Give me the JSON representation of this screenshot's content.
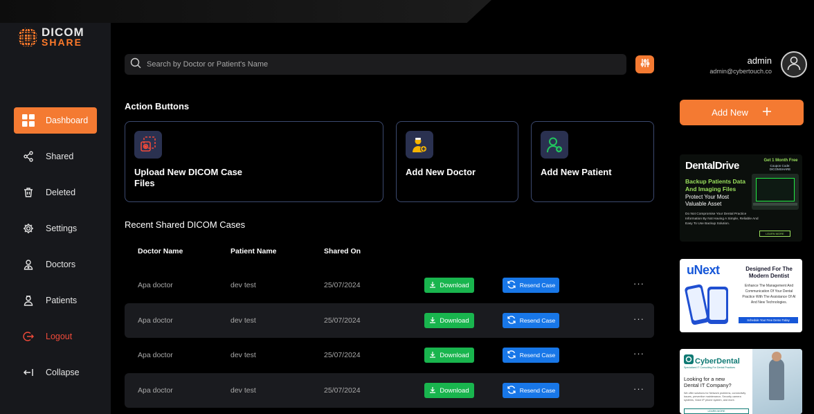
{
  "app": {
    "logo_line1": "DICOM",
    "logo_line2": "SHARE"
  },
  "colors": {
    "accent": "#f47a32",
    "download": "#19b54e",
    "resend": "#1877e8",
    "logout": "#f04a3a",
    "card_border": "#3c4a70"
  },
  "sidebar": {
    "items": [
      {
        "label": "Dashboard",
        "icon": "dashboard-icon"
      },
      {
        "label": "Shared",
        "icon": "share-icon"
      },
      {
        "label": "Deleted",
        "icon": "trash-icon"
      },
      {
        "label": "Settings",
        "icon": "gear-icon"
      },
      {
        "label": "Doctors",
        "icon": "doctor-icon"
      },
      {
        "label": "Patients",
        "icon": "patient-icon"
      },
      {
        "label": "Logout",
        "icon": "logout-icon"
      },
      {
        "label": "Collapse",
        "icon": "collapse-icon"
      }
    ]
  },
  "search": {
    "placeholder": "Search by Doctor or Patient's Name"
  },
  "user": {
    "name": "admin",
    "email": "admin@cybertouch.co"
  },
  "actions": {
    "title": "Action Buttons",
    "cards": [
      {
        "label": "Upload New DICOM Case Files",
        "icon": "upload-dicom-icon"
      },
      {
        "label": "Add New Doctor",
        "icon": "add-doctor-icon"
      },
      {
        "label": "Add New Patient",
        "icon": "add-patient-icon"
      }
    ]
  },
  "recent": {
    "title": "Recent Shared DICOM Cases",
    "columns": [
      "Doctor Name",
      "Patient Name",
      "Shared On"
    ],
    "rows": [
      {
        "doctor": "Apa doctor",
        "patient": "dev test",
        "date": "25/07/2024"
      },
      {
        "doctor": "Apa doctor",
        "patient": "dev test",
        "date": "25/07/2024"
      },
      {
        "doctor": "Apa doctor",
        "patient": "dev test",
        "date": "25/07/2024"
      },
      {
        "doctor": "Apa doctor",
        "patient": "dev test",
        "date": "25/07/2024"
      }
    ],
    "download_label": "Download",
    "resend_label": "Resend Case",
    "more_label": "···"
  },
  "right": {
    "add_new_label": "Add New",
    "ads": [
      {
        "brand": "DentalDrive",
        "promo": "Get 1 Month Free",
        "coupon": "Coupon Code: DICOMSHARE",
        "headline_1": "Backup Patients Data And Imaging Files",
        "headline_2": "Protect Your Most Valuable Asset",
        "body": "Do Not Compromise Your Dental Practice Information By Not Having A Simple, Reliable And Easy To Use Backup Solution.",
        "cta": "LEARN MORE"
      },
      {
        "brand": "uNext",
        "headline": "Designed For The Modern Dentist",
        "body": "Enhance The Management And Communication Of Your Dental Practice With The Assistance Of AI And New Technologies.",
        "cta": "Schedule Your Free Demo Today"
      },
      {
        "brand": "CyberDental",
        "tagline": "Specialized IT Consulting For Dental Practices",
        "headline": "Looking for a new Dental IT Company?",
        "body": "We offer solutions for Network problems, connectivity issues, preventive maintenance, Security camera systems, Voice IP phone system, and more.",
        "cta": "LEARN MORE"
      }
    ]
  }
}
